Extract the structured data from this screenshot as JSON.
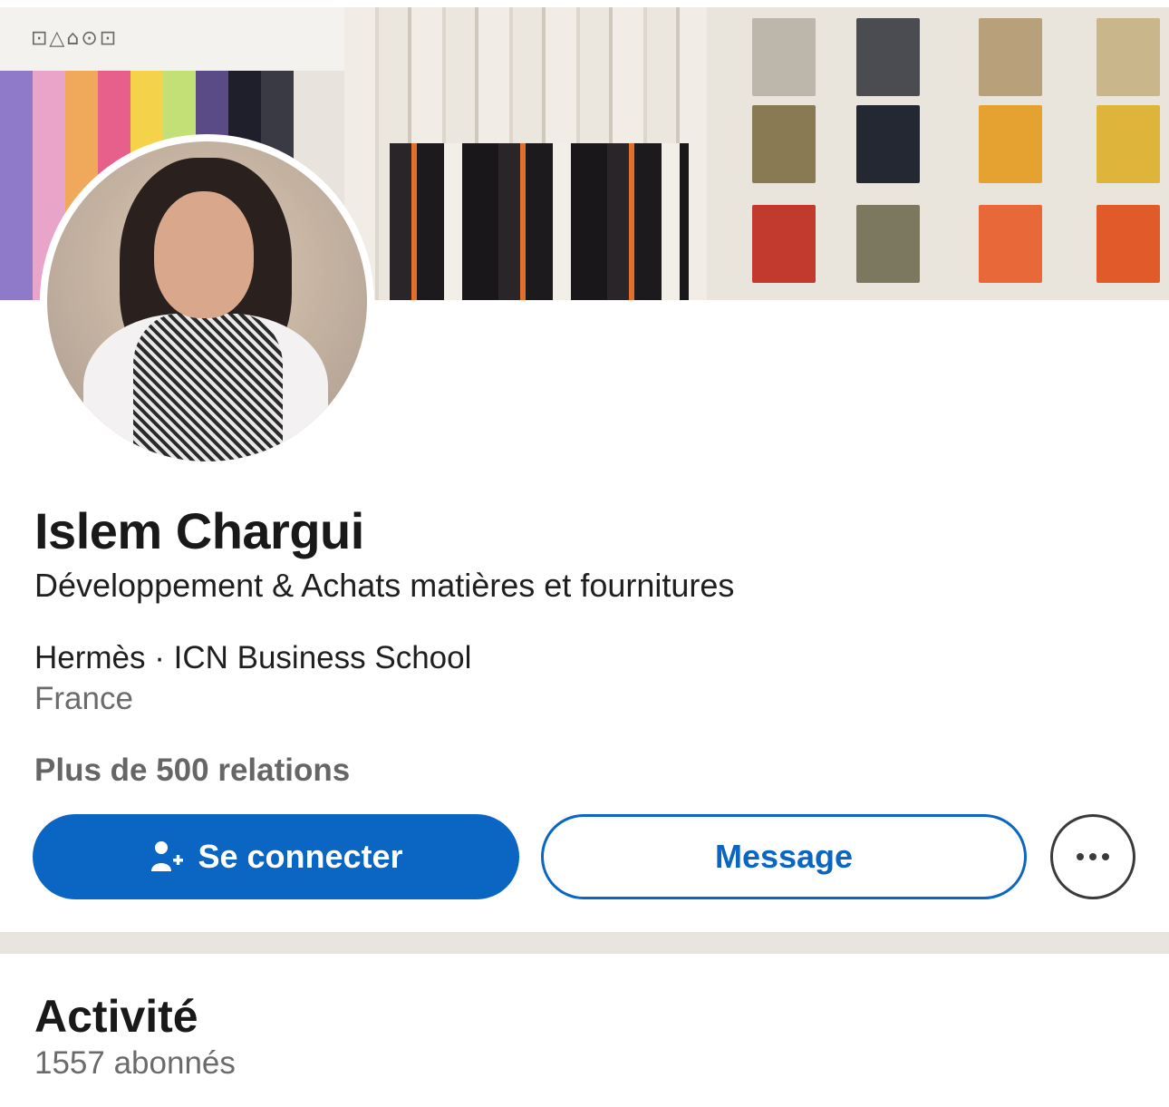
{
  "cover": {
    "care_symbols": "⊡△⌂⊙⊡"
  },
  "profile": {
    "name": "Islem Chargui",
    "headline": "Développement & Achats matières et fournitures",
    "company_education": "Hermès · ICN Business School",
    "location": "France",
    "connections": "Plus de 500 relations"
  },
  "actions": {
    "connect_label": "Se connecter",
    "message_label": "Message"
  },
  "activity": {
    "title": "Activité",
    "followers": "1557 abonnés"
  },
  "colors": {
    "primary": "#0a66c2",
    "text": "#191919",
    "muted": "#6b6b6b",
    "divider": "#e8e5df"
  },
  "icons": {
    "connect": "add-person-icon",
    "more": "more-horizontal-icon"
  }
}
